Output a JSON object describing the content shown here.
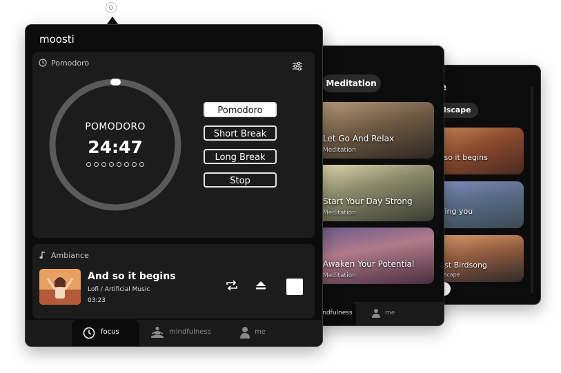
{
  "app": {
    "name": "moosti"
  },
  "front": {
    "pomodoro_label": "Pomodoro",
    "ring_title": "POMODORO",
    "timer": "24:47",
    "modes": [
      "Pomodoro",
      "Short Break",
      "Long Break",
      "Stop"
    ],
    "active_mode_index": 0,
    "session_dots": 8,
    "ambiance_label": "Ambiance",
    "track": {
      "title": "And so it begins",
      "artist": "Lofi / Artificial Music",
      "time": "03:23"
    },
    "tabs": [
      "focus",
      "mindfulness",
      "me"
    ],
    "active_tab": "focus"
  },
  "middle": {
    "category": "Meditation",
    "cards": [
      {
        "title": "Let Go And Relax",
        "subtitle": "Meditation"
      },
      {
        "title": "Start Your Day Strong",
        "subtitle": "Meditation"
      },
      {
        "title": "Awaken Your Potential",
        "subtitle": "Meditation"
      }
    ],
    "tab_active": "mindfulness",
    "tab_me": "me"
  },
  "back": {
    "title": "ce",
    "category": "ndscape",
    "cards": [
      {
        "title": "d so it begins",
        "subtitle": "i"
      },
      {
        "title": "ssing you",
        "subtitle": "i"
      },
      {
        "title": "rest Birdsong",
        "subtitle": "ndscape"
      }
    ]
  },
  "colors": {
    "window": "#0c0c0c",
    "panel": "#1c1c1c",
    "ring": "#5a5a5a",
    "accent": "#ffffff"
  },
  "icons": [
    "clock-icon",
    "settings-sliders-icon",
    "music-note-icon",
    "repeat-icon",
    "eject-icon",
    "stop-icon",
    "meditation-icon",
    "person-icon"
  ]
}
